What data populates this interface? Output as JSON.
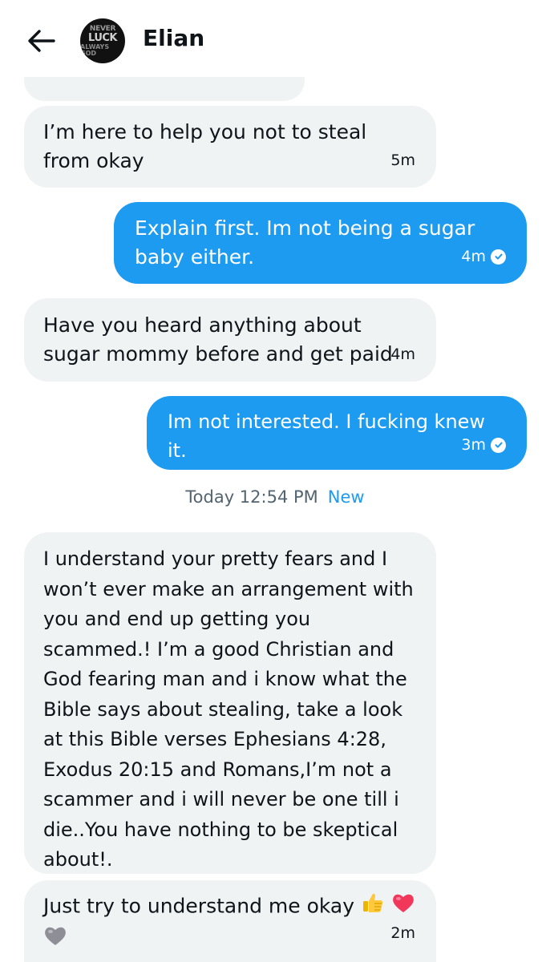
{
  "header": {
    "contact_name": "Elian",
    "avatar_lines": [
      "NEVER",
      "LUCK",
      "ALWAYS GOD"
    ]
  },
  "messages": [
    {
      "direction": "in",
      "text": "I’m here to help you not to steal from okay",
      "time": "5m"
    },
    {
      "direction": "out",
      "text": "Explain first. Im not being a sugar baby either.",
      "time": "4m",
      "read": true
    },
    {
      "direction": "in",
      "text": "Have you heard anything about sugar mommy before and get paid",
      "time": "4m"
    },
    {
      "direction": "out",
      "text": "Im not interested. I fucking knew it.",
      "time": "3m",
      "read": true
    },
    {
      "direction": "in",
      "text": "I understand your pretty fears and I won’t ever make an arrangement with you and end up getting you scammed.! I’m a good Christian and God fearing man and i know what the Bible says about stealing, take a look at this Bible verses Ephesians 4:28, Exodus 20:15 and Romans,I’m not a scammer and i will never be one till i die..You have nothing to be skeptical about!.",
      "time": ""
    },
    {
      "direction": "in",
      "text": "Just try to understand me okay",
      "emojis": [
        "thumbs-up",
        "red-heart",
        "grey-heart"
      ],
      "time": "2m"
    }
  ],
  "divider": {
    "time": "Today 12:54 PM",
    "label": "New"
  },
  "colors": {
    "outgoing": "#1d9bf0",
    "incoming": "#eff3f4",
    "accent": "#1d9bf0"
  }
}
